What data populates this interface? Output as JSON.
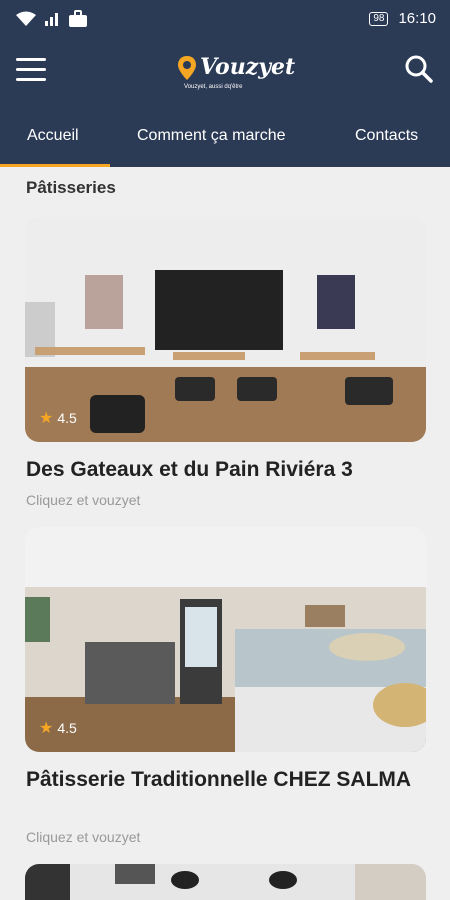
{
  "status": {
    "time": "16:10",
    "battery": "98"
  },
  "app": {
    "brand": "Vouzyet",
    "tagline": "Vouzyet, aussi dq'être"
  },
  "tabs": [
    {
      "label": "Accueil",
      "active": true
    },
    {
      "label": "Comment ça marche"
    },
    {
      "label": "Contacts"
    }
  ],
  "section": {
    "title": "Pâtisseries"
  },
  "cards": [
    {
      "title": "Des Gateaux et du Pain Riviéra 3",
      "subtitle": "Cliquez et vouzyet",
      "rating": "4.5"
    },
    {
      "title": "Pâtisserie Traditionnelle CHEZ SALMA",
      "subtitle": "Cliquez et vouzyet",
      "rating": "4.5"
    }
  ],
  "colors": {
    "header": "#2b3a55",
    "accent": "#f5a623",
    "background": "#efefef"
  },
  "icons": [
    "wifi-icon",
    "signal-icon",
    "sim-icon",
    "briefcase-icon",
    "battery-icon",
    "menu-icon",
    "location-pin-icon",
    "search-icon",
    "star-icon"
  ]
}
